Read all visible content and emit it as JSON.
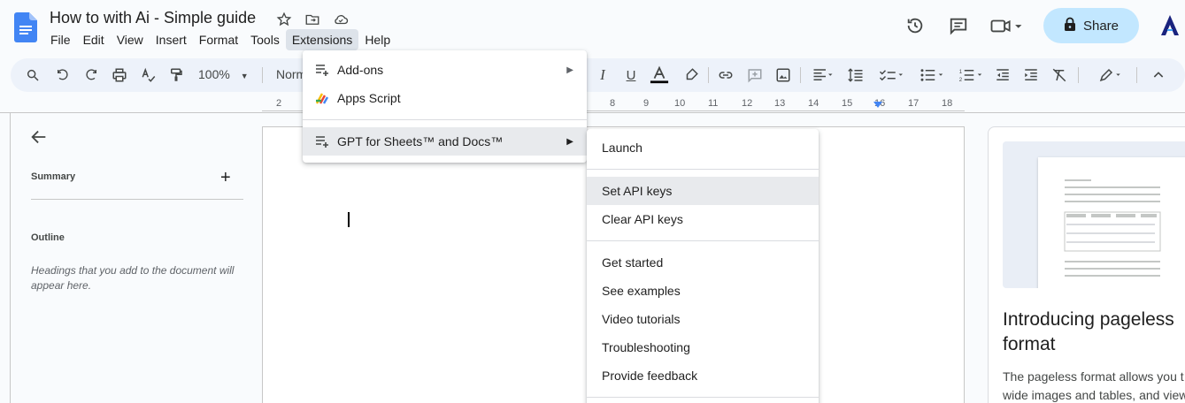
{
  "doc": {
    "title": "How to with Ai - Simple guide"
  },
  "menubar": [
    "File",
    "Edit",
    "View",
    "Insert",
    "Format",
    "Tools",
    "Extensions",
    "Help"
  ],
  "share": {
    "label": "Share"
  },
  "toolbar": {
    "zoom": "100%",
    "style": "Norm"
  },
  "ruler": [
    "2",
    "8",
    "9",
    "10",
    "11",
    "12",
    "13",
    "14",
    "15",
    "16",
    "17",
    "18"
  ],
  "sidebar": {
    "summary": "Summary",
    "outline": "Outline",
    "outline_hint": "Headings that you add to the document will appear here."
  },
  "ext_menu": {
    "addons": "Add-ons",
    "apps_script": "Apps Script",
    "gpt": "GPT for Sheets™ and Docs™"
  },
  "gpt_menu": {
    "launch": "Launch",
    "set_keys": "Set API keys",
    "clear_keys": "Clear API keys",
    "get_started": "Get started",
    "examples": "See examples",
    "tutorials": "Video tutorials",
    "troubleshooting": "Troubleshooting",
    "feedback": "Provide feedback"
  },
  "card": {
    "title_l1": "Introducing pageless",
    "title_l2": "format",
    "desc_l1": "The pageless format allows you t",
    "desc_l2": "wide images and tables, and view"
  }
}
